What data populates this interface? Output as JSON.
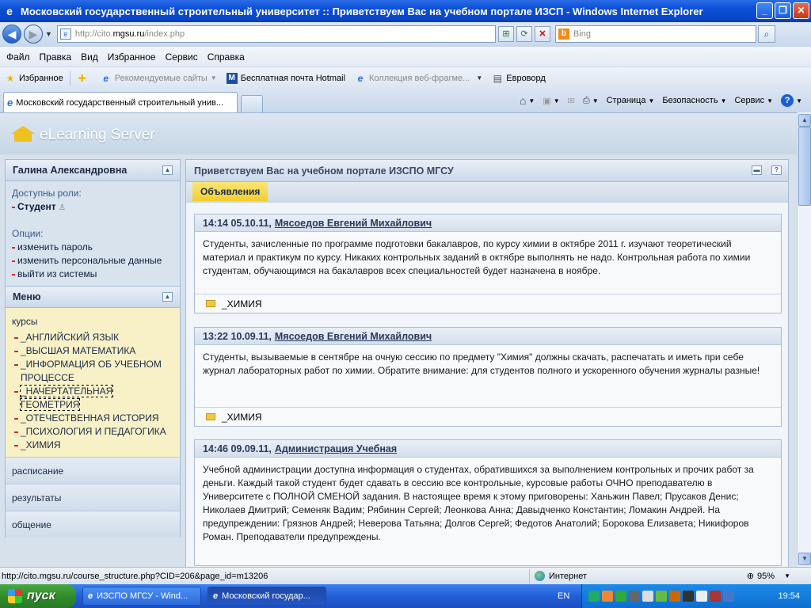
{
  "window": {
    "title": "Московский государственный строительный университет :: Приветствуем Вас на учебном портале ИЗСП - Windows Internet Explorer"
  },
  "address": {
    "url_prefix": "http://cito.",
    "url_host": "mgsu.ru",
    "url_suffix": "/index.php",
    "search_placeholder": "Bing"
  },
  "menu": [
    "Файл",
    "Правка",
    "Вид",
    "Избранное",
    "Сервис",
    "Справка"
  ],
  "favorites": {
    "label": "Избранное",
    "items": [
      "Рекомендуемые сайты",
      "Бесплатная почта Hotmail",
      "Коллекция веб-фрагме...",
      "Евроворд"
    ]
  },
  "tab": {
    "title": "Московский государственный строительный унив..."
  },
  "commands": {
    "page": "Страница",
    "safety": "Безопасность",
    "tools": "Сервис",
    "help": "?"
  },
  "site": {
    "logo": "eLearning Server"
  },
  "sidebar": {
    "user": "Галина  Александровна",
    "roles_label": "Доступны роли:",
    "role": "Студент",
    "options_label": "Опции:",
    "options": [
      "изменить пароль",
      "изменить персональные данные",
      "выйти из системы"
    ],
    "menu_title": "Меню",
    "courses_label": "курсы",
    "courses": [
      "_АНГЛИЙСКИЙ ЯЗЫК",
      "_ВЫСШАЯ МАТЕМАТИКА",
      "_ИНФОРМАЦИЯ ОБ УЧЕБНОМ",
      "ПРОЦЕССЕ",
      "_НАЧЕРТАТЕЛЬНАЯ ГЕОМЕТРИЯ",
      "_ОТЕЧЕСТВЕННАЯ ИСТОРИЯ",
      "_ПСИХОЛОГИЯ И ПЕДАГОГИКА",
      "_ХИМИЯ"
    ],
    "sections": [
      "расписание",
      "результаты",
      "общение"
    ]
  },
  "main": {
    "title": "Приветствуем Вас на учебном портале ИЗСПО МГСУ",
    "tab": "Объявления",
    "news": [
      {
        "time": "14:14 05.10.11,",
        "author": "Мясоедов Евгений Михайлович",
        "text": "Студенты, зачисленные по программе подготовки бакалавров, по курсу химии в октябре 2011 г. изучают теоретический материал и практикум по курсу. Никаких контрольных заданий в октябре выполнять не надо. Контрольная работа по химии студентам, обучающимся на бакалавров всех специальностей будет назначена в ноябре.",
        "folder": "_ХИМИЯ"
      },
      {
        "time": "13:22 10.09.11,",
        "author": "Мясоедов Евгений Михайлович",
        "text": "Студенты, вызываемые в сентябре на очную сессию по предмету \"Химия\" должны скачать, распечатать и иметь при себе журнал лабораторных работ по химии. Обратите внимание: для студентов полного и ускоренного обучения журналы разные!",
        "folder": "_ХИМИЯ"
      },
      {
        "time": "14:46 09.09.11,",
        "author": "Администрация Учебная",
        "text": "Учебной администрации доступна информация о студентах, обратившихся за выполнением контрольных и прочих работ за деньги. Каждый такой студент будет сдавать в сессию все контрольные, курсовые работы ОЧНО преподавателю в Университете с ПОЛНОЙ СМЕНОЙ задания. В настоящее время к этому приговорены: Ханьжин Павел; Прусаков Денис; Николаев Дмитрий; Семеняк Вадим; Рябинин Сергей; Леонкова Анна; Давыдченко Константин; Ломакин Андрей. На предупреждении: Грязнов Андрей; Неверова Татьяна; Долгов Сергей; Федотов Анатолий; Борокова Елизавета; Никифоров Роман. Преподаватели предупреждены.",
        "folder": ""
      }
    ]
  },
  "status": {
    "url": "http://cito.mgsu.ru/course_structure.php?CID=206&page_id=m13206",
    "zone": "Интернет",
    "zoom": "95%"
  },
  "taskbar": {
    "start": "пуск",
    "tasks": [
      "ИЗСПО МГСУ - Wind...",
      "Московский государ..."
    ],
    "lang": "EN",
    "clock": "19:54"
  }
}
